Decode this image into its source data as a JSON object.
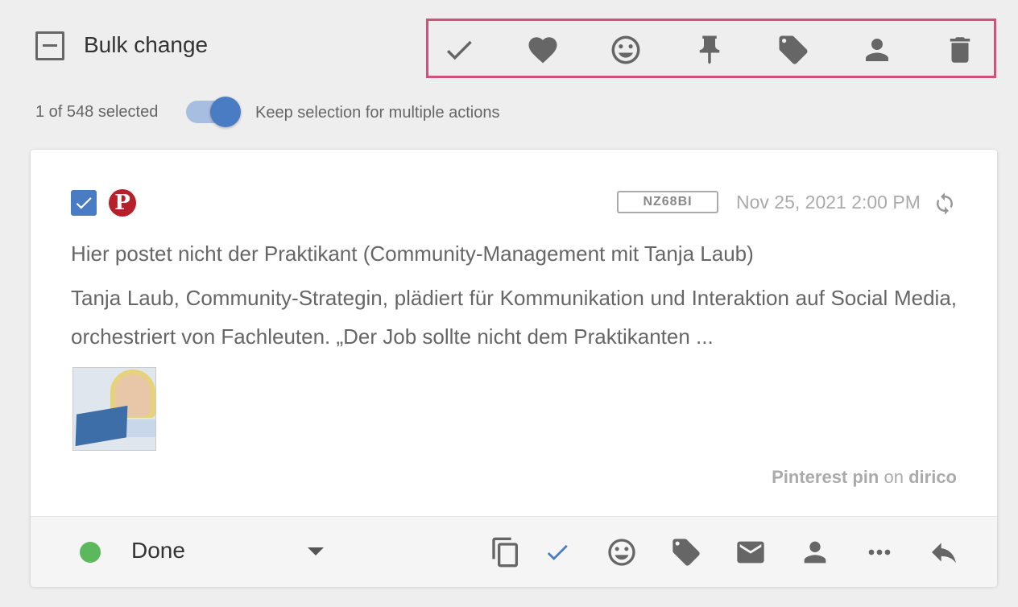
{
  "header": {
    "title": "Bulk change"
  },
  "bulk_actions": [
    {
      "name": "check-icon"
    },
    {
      "name": "heart-icon"
    },
    {
      "name": "smiley-icon"
    },
    {
      "name": "pin-icon"
    },
    {
      "name": "tag-icon"
    },
    {
      "name": "person-icon"
    },
    {
      "name": "trash-icon"
    }
  ],
  "selection": {
    "count_text": "1 of 548 selected",
    "keep_label": "Keep selection for multiple actions",
    "keep_enabled": true
  },
  "post": {
    "code": "NZ68BI",
    "timestamp": "Nov 25, 2021 2:00 PM",
    "title": "Hier postet nicht der Praktikant (Community-Management mit Tanja Laub)",
    "body": "Tanja Laub, Community-Strategin, plädiert für Kommunikation und Interaktion auf Social Media, orchestriert von Fachleuten. „Der Job sollte nicht dem Praktikanten ...",
    "source_type": "Pinterest pin",
    "source_on": "on",
    "source_account": "dirico"
  },
  "footer": {
    "status_label": "Done",
    "status_color": "#5cb85c"
  },
  "colors": {
    "accent": "#4a7cc4",
    "highlight_border": "#d0527a",
    "pinterest": "#b7202a"
  }
}
